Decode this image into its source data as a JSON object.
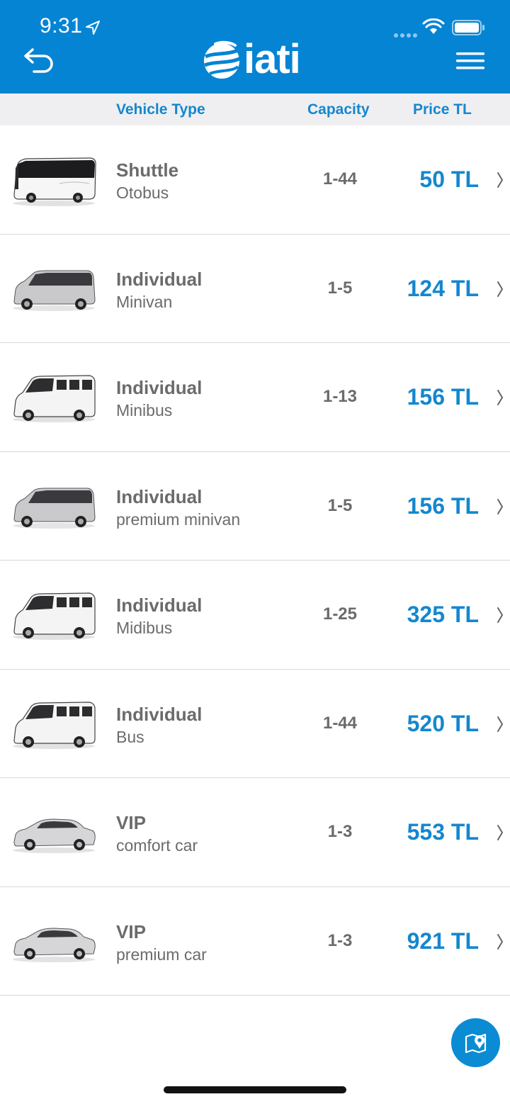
{
  "status_bar": {
    "time": "9:31"
  },
  "app": {
    "logo_text": "iati"
  },
  "columns": {
    "vehicle_type": "Vehicle Type",
    "capacity": "Capacity",
    "price": "Price TL"
  },
  "rows": [
    {
      "category": "Shuttle",
      "vehicle": "Otobus",
      "capacity": "1-44",
      "price": "50 TL",
      "image": "coach-bus"
    },
    {
      "category": "Individual",
      "vehicle": "Minivan",
      "capacity": "1-5",
      "price": "124 TL",
      "image": "minivan"
    },
    {
      "category": "Individual",
      "vehicle": "Minibus",
      "capacity": "1-13",
      "price": "156 TL",
      "image": "sprinter-van"
    },
    {
      "category": "Individual",
      "vehicle": "premium minivan",
      "capacity": "1-5",
      "price": "156 TL",
      "image": "minivan"
    },
    {
      "category": "Individual",
      "vehicle": "Midibus",
      "capacity": "1-25",
      "price": "325 TL",
      "image": "sprinter-van"
    },
    {
      "category": "Individual",
      "vehicle": "Bus",
      "capacity": "1-44",
      "price": "520 TL",
      "image": "sprinter-van"
    },
    {
      "category": "VIP",
      "vehicle": "comfort car",
      "capacity": "1-3",
      "price": "553 TL",
      "image": "sedan"
    },
    {
      "category": "VIP",
      "vehicle": "premium car",
      "capacity": "1-3",
      "price": "921 TL",
      "image": "sedan"
    }
  ],
  "colors": {
    "brand": "#0584d4",
    "accent_text": "#1487cf",
    "body_text": "#6b6b6e",
    "header_bg": "#efeff1"
  },
  "icons": {
    "back": "back-arrow-icon",
    "menu": "hamburger-menu-icon",
    "fab": "map-pin-icon",
    "row": "chevron-right-icon"
  }
}
